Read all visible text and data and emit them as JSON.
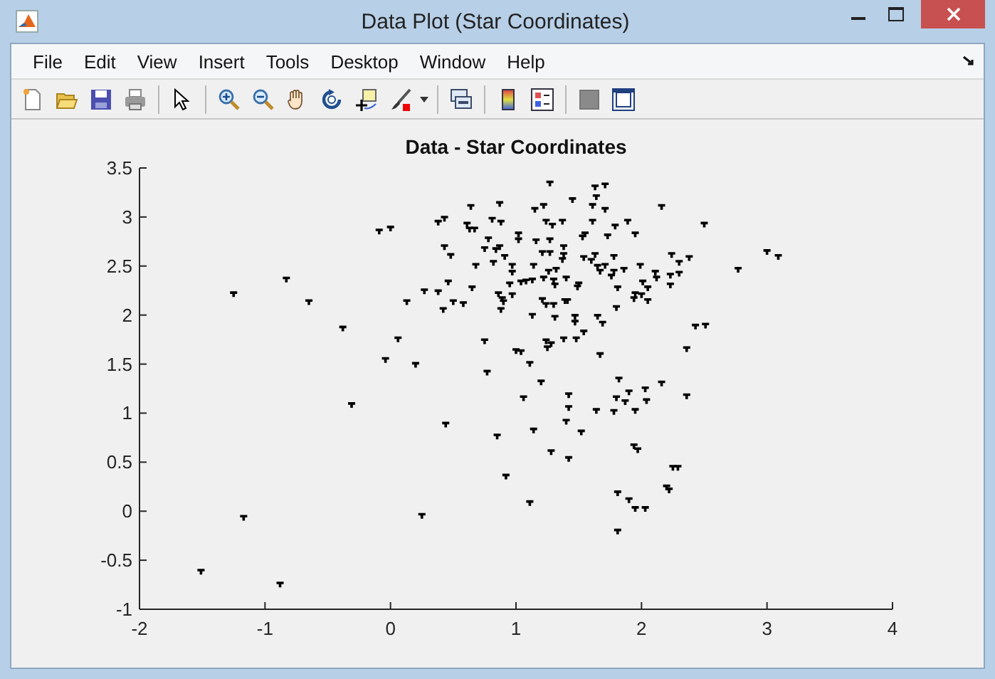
{
  "window": {
    "title": "Data Plot (Star Coordinates)"
  },
  "menu": [
    "File",
    "Edit",
    "View",
    "Insert",
    "Tools",
    "Desktop",
    "Window",
    "Help"
  ],
  "figure": {
    "chart_data": {
      "type": "scatter",
      "title": "Data - Star Coordinates",
      "x": [
        -1.51,
        -1.17,
        -0.88,
        0.25,
        -1.25,
        -0.83,
        -0.65,
        -0.38,
        -0.04,
        -0.31,
        -0.09,
        0.0,
        0.06,
        0.13,
        0.2,
        0.27,
        0.44,
        0.85,
        0.92,
        1.27,
        1.63,
        1.71,
        1.64,
        1.45,
        1.61,
        1.71,
        2.16,
        0.64,
        0.87,
        1.22,
        1.15,
        0.38,
        0.43,
        0.61,
        0.81,
        0.88,
        1.24,
        1.29,
        1.37,
        1.61,
        1.89,
        2.5,
        0.63,
        0.67,
        1.79,
        1.02,
        1.02,
        0.78,
        1.95,
        1.73,
        1.53,
        1.55,
        1.27,
        1.16,
        0.43,
        0.48,
        0.75,
        0.84,
        0.87,
        0.91,
        1.21,
        1.27,
        1.38,
        1.38,
        1.37,
        1.54,
        1.6,
        1.63,
        1.78,
        3.0,
        3.09,
        2.77,
        2.24,
        2.3,
        2.38,
        0.68,
        0.82,
        0.97,
        0.97,
        1.14,
        1.26,
        1.32,
        1.65,
        1.67,
        1.71,
        1.78,
        1.86,
        1.99,
        2.11,
        2.12,
        2.23,
        2.3,
        0.46,
        0.38,
        0.65,
        0.95,
        1.04,
        1.08,
        1.13,
        1.22,
        1.3,
        1.31,
        1.4,
        1.5,
        1.49,
        1.76,
        1.81,
        2.01,
        2.05,
        2.23,
        0.86,
        0.97,
        0.89,
        0.9,
        1.95,
        1.94,
        2.0,
        2.05,
        0.42,
        0.5,
        0.58,
        0.88,
        1.21,
        1.24,
        1.3,
        1.39,
        1.41,
        1.8,
        1.13,
        1.31,
        1.47,
        1.47,
        1.65,
        1.69,
        2.43,
        2.51,
        0.75,
        1.0,
        1.04,
        1.24,
        1.28,
        1.25,
        1.38,
        1.48,
        1.54,
        2.36,
        1.11,
        1.67,
        0.77,
        1.2,
        1.82,
        2.16,
        1.06,
        1.42,
        1.8,
        1.9,
        2.03,
        2.04,
        1.87,
        2.36,
        1.42,
        1.64,
        1.78,
        1.95,
        1.4,
        1.14,
        1.52,
        1.28,
        1.42,
        1.94,
        1.97,
        2.29,
        2.25,
        2.2,
        2.22,
        1.81,
        1.9,
        1.95,
        2.03,
        1.11,
        1.81
      ],
      "series": [
        {
          "color": "#000000",
          "values": [
            -0.61,
            -0.06,
            -0.74,
            -0.04,
            2.22,
            2.37,
            2.14,
            1.87,
            1.55,
            1.09,
            2.86,
            2.89,
            1.76,
            2.14,
            1.5,
            2.25,
            0.89,
            0.77,
            0.36,
            3.35,
            3.31,
            3.33,
            3.21,
            3.18,
            3.12,
            3.08,
            3.11,
            3.11,
            3.14,
            3.12,
            3.08,
            2.95,
            2.99,
            2.93,
            2.98,
            2.95,
            2.96,
            2.92,
            2.96,
            2.96,
            2.96,
            2.93,
            2.88,
            2.88,
            2.91,
            2.83,
            2.77,
            2.78,
            2.83,
            2.81,
            2.8,
            2.83,
            2.77,
            2.76,
            2.7,
            2.61,
            2.68,
            2.67,
            2.7,
            2.6,
            2.64,
            2.64,
            2.7,
            2.62,
            2.57,
            2.59,
            2.56,
            2.62,
            2.6,
            2.65,
            2.6,
            2.47,
            2.62,
            2.54,
            2.59,
            2.51,
            2.54,
            2.51,
            2.44,
            2.51,
            2.45,
            2.47,
            2.5,
            2.45,
            2.51,
            2.45,
            2.47,
            2.51,
            2.44,
            2.38,
            2.41,
            2.43,
            2.34,
            2.24,
            2.28,
            2.32,
            2.34,
            2.35,
            2.36,
            2.38,
            2.36,
            2.31,
            2.38,
            2.32,
            2.29,
            2.4,
            2.28,
            2.34,
            2.28,
            2.31,
            2.22,
            2.21,
            2.17,
            2.14,
            2.22,
            2.17,
            2.21,
            2.15,
            2.06,
            2.14,
            2.12,
            2.06,
            2.16,
            2.11,
            2.11,
            2.15,
            2.15,
            2.08,
            2.0,
            1.98,
            1.99,
            1.93,
            1.99,
            1.92,
            1.89,
            1.9,
            1.74,
            1.64,
            1.63,
            1.74,
            1.71,
            1.67,
            1.76,
            1.76,
            1.83,
            1.66,
            1.51,
            1.6,
            1.42,
            1.32,
            1.35,
            1.31,
            1.16,
            1.19,
            1.16,
            1.22,
            1.25,
            1.13,
            1.12,
            1.18,
            1.06,
            1.03,
            1.02,
            1.03,
            0.92,
            0.83,
            0.81,
            0.61,
            0.54,
            0.67,
            0.63,
            0.45,
            0.45,
            0.25,
            0.22,
            0.19,
            0.12,
            0.03,
            0.03,
            0.09,
            -0.2
          ]
        }
      ],
      "xlim": [
        -2,
        4
      ],
      "ylim": [
        -1,
        3.5
      ],
      "xticks": [
        -2,
        -1,
        0,
        1,
        2,
        3,
        4
      ],
      "yticks": [
        -1,
        -0.5,
        0,
        0.5,
        1,
        1.5,
        2,
        2.5,
        3,
        3.5
      ]
    }
  }
}
